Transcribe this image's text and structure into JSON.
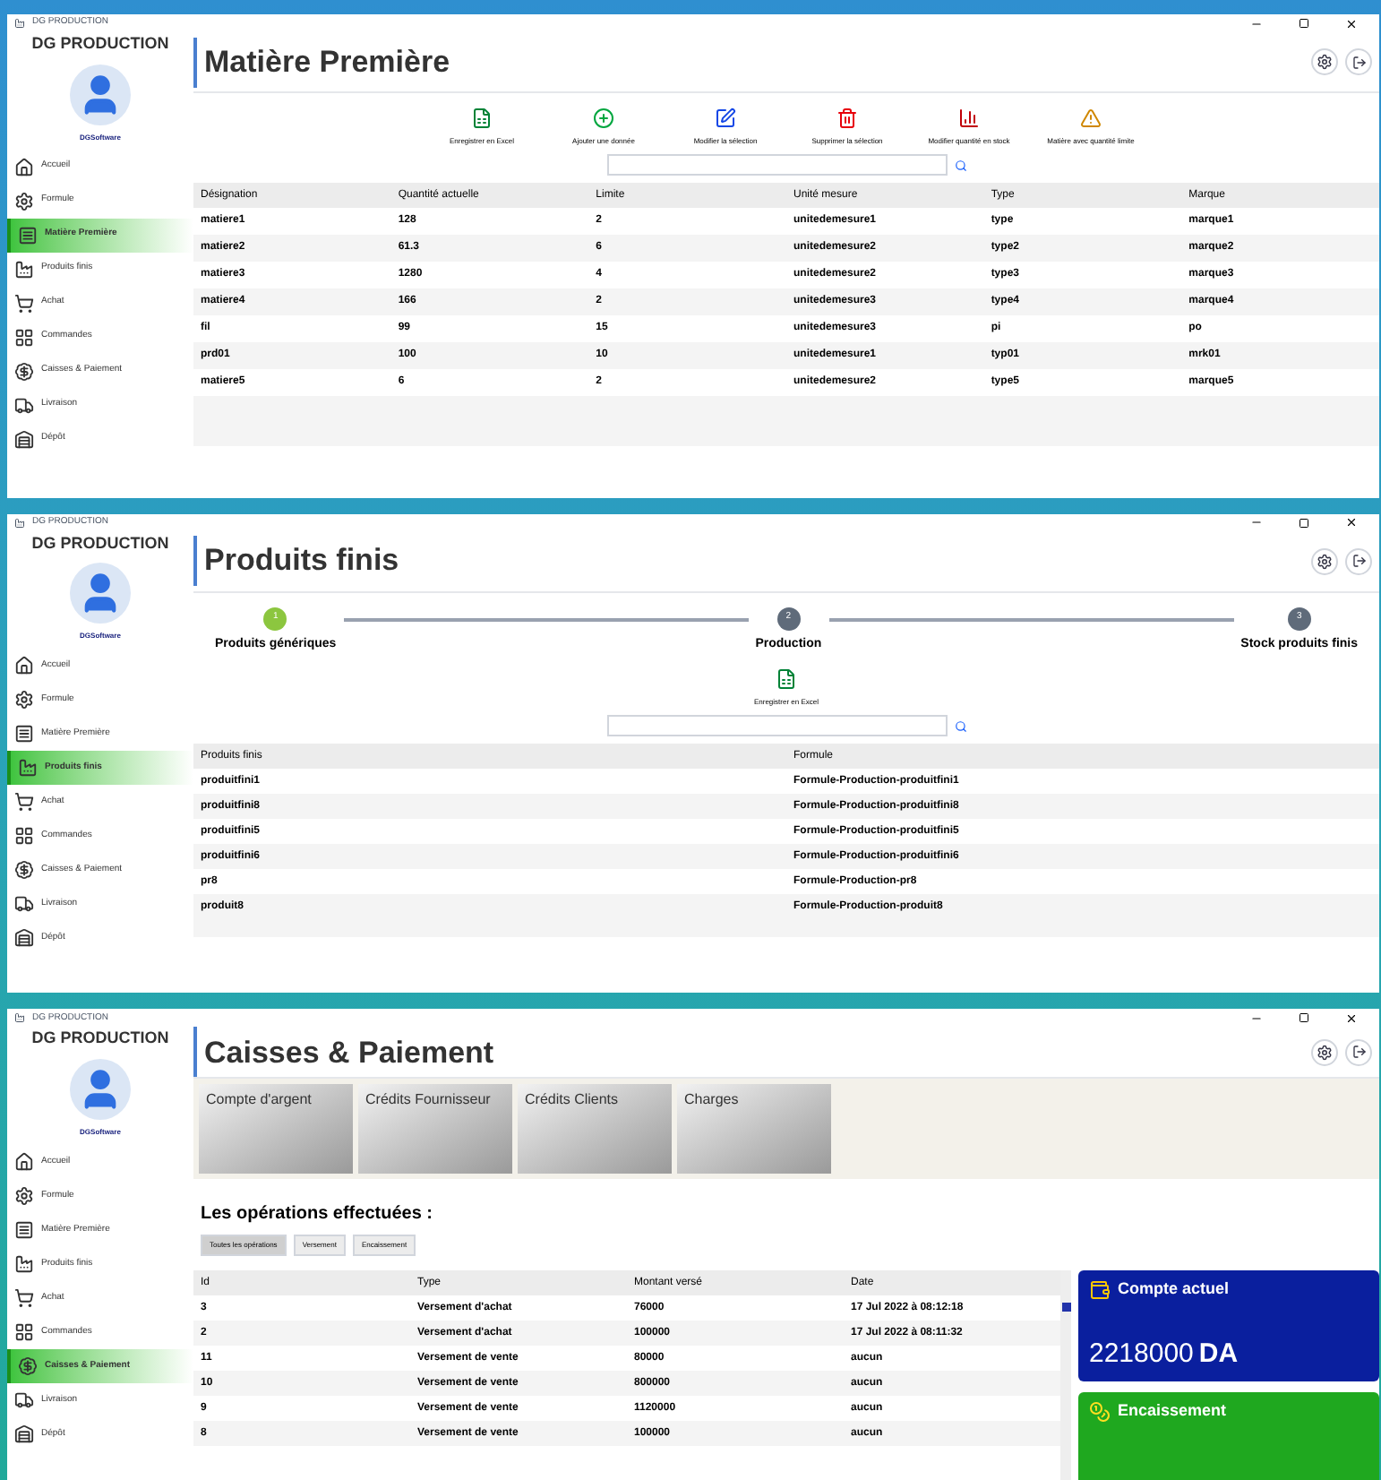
{
  "windows": [
    {
      "title": "DG PRODUCTION",
      "brand": "DG PRODUCTION",
      "user": "DGSoftware",
      "page_title": "Matière Première",
      "nav": [
        {
          "label": "Accueil",
          "selected": false
        },
        {
          "label": "Formule",
          "selected": false
        },
        {
          "label": "Matière Première",
          "selected": true
        },
        {
          "label": "Produits finis",
          "selected": false
        },
        {
          "label": "Achat",
          "selected": false
        },
        {
          "label": "Commandes",
          "selected": false
        },
        {
          "label": "Caisses & Paiement",
          "selected": false
        },
        {
          "label": "Livraison",
          "selected": false
        },
        {
          "label": "Dépôt",
          "selected": false
        }
      ],
      "content": {
        "kind": "materials",
        "toolbar": [
          "Enregistrer en Excel",
          "Ajouter une donnée",
          "Modifier la sélection",
          "Supprimer la sélection",
          "Modifier quantité en stock",
          "Matière avec quantité limite"
        ],
        "table": {
          "columns": [
            "Désignation",
            "Quantité actuelle",
            "Limite",
            "Unité mesure",
            "Type",
            "Marque"
          ],
          "rows": [
            [
              "matiere1",
              "128",
              "2",
              "unitedemesure1",
              "type",
              "marque1"
            ],
            [
              "matiere2",
              "61.3",
              "6",
              "unitedemesure2",
              "type2",
              "marque2"
            ],
            [
              "matiere3",
              "1280",
              "4",
              "unitedemesure2",
              "type3",
              "marque3"
            ],
            [
              "matiere4",
              "166",
              "2",
              "unitedemesure3",
              "type4",
              "marque4"
            ],
            [
              "fil",
              "99",
              "15",
              "unitedemesure3",
              "pi",
              "po"
            ],
            [
              "prd01",
              "100",
              "10",
              "unitedemesure1",
              "typ01",
              "mrk01"
            ],
            [
              "matiere5",
              "6",
              "2",
              "unitedemesure2",
              "type5",
              "marque5"
            ]
          ]
        }
      }
    },
    {
      "title": "DG PRODUCTION",
      "brand": "DG PRODUCTION",
      "user": "DGSoftware",
      "page_title": "Produits finis",
      "nav": [
        {
          "label": "Accueil",
          "selected": false
        },
        {
          "label": "Formule",
          "selected": false
        },
        {
          "label": "Matière Première",
          "selected": false
        },
        {
          "label": "Produits finis",
          "selected": true
        },
        {
          "label": "Achat",
          "selected": false
        },
        {
          "label": "Commandes",
          "selected": false
        },
        {
          "label": "Caisses & Paiement",
          "selected": false
        },
        {
          "label": "Livraison",
          "selected": false
        },
        {
          "label": "Dépôt",
          "selected": false
        }
      ],
      "content": {
        "kind": "production",
        "steps": [
          {
            "number": "1",
            "label": "Produits génériques",
            "selected": true
          },
          {
            "number": "2",
            "label": "Production",
            "selected": false
          },
          {
            "number": "3",
            "label": "Stock produits finis",
            "selected": false
          }
        ],
        "toolbar": [
          "Enregistrer en Excel"
        ],
        "table": {
          "columns": [
            "Produits finis",
            "Formule"
          ],
          "rows": [
            [
              "produitfini1",
              "Formule-Production-produitfini1"
            ],
            [
              "produitfini8",
              "Formule-Production-produitfini8"
            ],
            [
              "produitfini5",
              "Formule-Production-produitfini5"
            ],
            [
              "produitfini6",
              "Formule-Production-produitfini6"
            ],
            [
              "pr8",
              "Formule-Production-pr8"
            ],
            [
              "produit8",
              "Formule-Production-produit8"
            ]
          ]
        }
      }
    },
    {
      "title": "DG PRODUCTION",
      "brand": "DG PRODUCTION",
      "user": "DGSoftware",
      "page_title": "Caisses & Paiement",
      "nav": [
        {
          "label": "Accueil",
          "selected": false
        },
        {
          "label": "Formule",
          "selected": false
        },
        {
          "label": "Matière Première",
          "selected": false
        },
        {
          "label": "Produits finis",
          "selected": false
        },
        {
          "label": "Achat",
          "selected": false
        },
        {
          "label": "Commandes",
          "selected": false
        },
        {
          "label": "Caisses & Paiement",
          "selected": true
        },
        {
          "label": "Livraison",
          "selected": false
        },
        {
          "label": "Dépôt",
          "selected": false
        }
      ],
      "content": {
        "kind": "payments",
        "tiles": [
          "Compte d'argent",
          "Crédits Fournisseur",
          "Crédits Clients",
          "Charges"
        ],
        "section_title": "Les opérations effectuées :",
        "filters": [
          {
            "label": "Toutes les opérations",
            "selected": true
          },
          {
            "label": "Versement",
            "selected": false
          },
          {
            "label": "Encaissement",
            "selected": false
          }
        ],
        "table": {
          "columns": [
            "Id",
            "Type",
            "Montant versé",
            "Date"
          ],
          "rows": [
            [
              "3",
              "Versement d'achat",
              "76000",
              "17 Jul 2022 à 08:12:18"
            ],
            [
              "2",
              "Versement d'achat",
              "100000",
              "17 Jul 2022 à 08:11:32"
            ],
            [
              "11",
              "Versement de vente",
              "80000",
              "aucun"
            ],
            [
              "10",
              "Versement de vente",
              "800000",
              "aucun"
            ],
            [
              "9",
              "Versement de vente",
              "1120000",
              "aucun"
            ],
            [
              "8",
              "Versement de vente",
              "100000",
              "aucun"
            ]
          ]
        },
        "cards": [
          {
            "title": "Compte actuel",
            "value": "2218000",
            "unit": "DA",
            "color": "#0a1f9e"
          },
          {
            "title": "Encaissement",
            "color": "#1fa81f"
          }
        ]
      }
    }
  ]
}
